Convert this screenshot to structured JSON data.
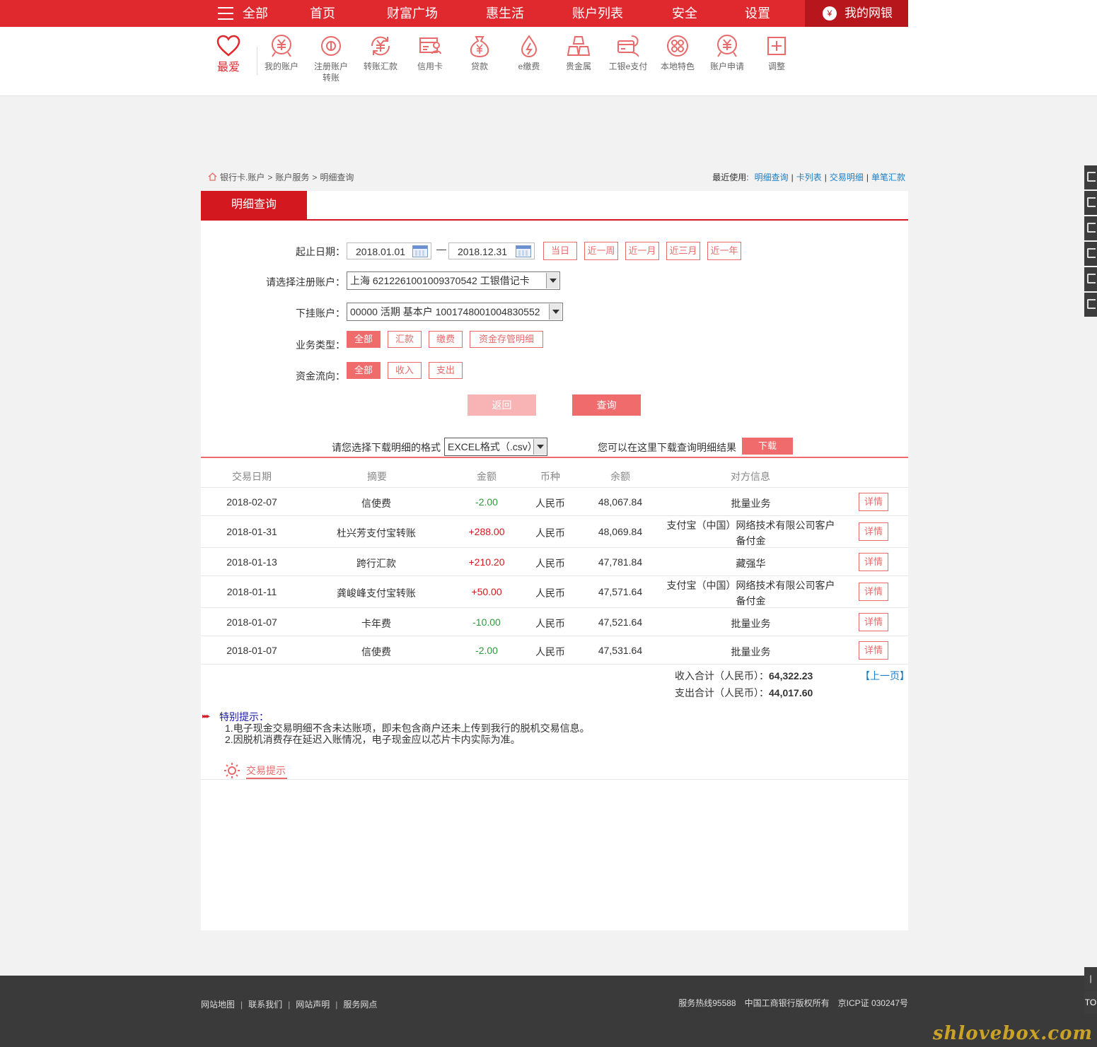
{
  "topnav": {
    "all": "全部",
    "items": [
      "首页",
      "财富广场",
      "惠生活",
      "账户列表",
      "安全",
      "设置"
    ],
    "mybank": "我的网银"
  },
  "iconbar": {
    "favorite": "最爱",
    "items": [
      "我的账户",
      "注册账户转账",
      "转账汇款",
      "信用卡",
      "贷款",
      "e缴费",
      "贵金属",
      "工银e支付",
      "本地特色",
      "账户申请",
      "调整"
    ]
  },
  "breadcrumb": [
    "银行卡.账户",
    "账户服务",
    "明细查询"
  ],
  "recent": {
    "label": "最近使用:",
    "links": [
      "明细查询",
      "卡列表",
      "交易明细",
      "单笔汇款"
    ]
  },
  "tab": "明细查询",
  "form": {
    "date_label": "起止日期：",
    "start_date": "2018.01.01",
    "end_date": "2018.12.31",
    "quick_ranges": [
      "当日",
      "近一周",
      "近一月",
      "近三月",
      "近一年"
    ],
    "account_label": "请选择注册账户：",
    "account_value": "上海 6212261001009370542 工银借记卡",
    "sub_account_label": "下挂账户：",
    "sub_account_value": "00000 活期 基本户 1001748001004830552",
    "biz_type_label": "业务类型：",
    "biz_types": [
      "全部",
      "汇款",
      "缴费",
      "资金存管明细"
    ],
    "flow_label": "资金流向：",
    "flows": [
      "全部",
      "收入",
      "支出"
    ],
    "back": "返回",
    "query": "查询"
  },
  "download": {
    "format_label": "请您选择下载明细的格式",
    "format_value": "EXCEL格式（.csv）",
    "hint": "您可以在这里下载查询明细结果",
    "button": "下载"
  },
  "table": {
    "headers": [
      "交易日期",
      "摘要",
      "金额",
      "币种",
      "余额",
      "对方信息"
    ],
    "rows": [
      {
        "date": "2018-02-07",
        "summary": "信使费",
        "amount": "-2.00",
        "currency": "人民币",
        "balance": "48,067.84",
        "party": "批量业务",
        "party2": "",
        "detail": "详情"
      },
      {
        "date": "2018-01-31",
        "summary": "杜兴芳支付宝转账",
        "amount": "+288.00",
        "currency": "人民币",
        "balance": "48,069.84",
        "party": "支付宝（中国）网络技术有限公司客户",
        "party2": "备付金",
        "detail": "详情"
      },
      {
        "date": "2018-01-13",
        "summary": "跨行汇款",
        "amount": "+210.20",
        "currency": "人民币",
        "balance": "47,781.84",
        "party": "藏强华",
        "party2": "",
        "detail": "详情"
      },
      {
        "date": "2018-01-11",
        "summary": "龚峻峰支付宝转账",
        "amount": "+50.00",
        "currency": "人民币",
        "balance": "47,571.64",
        "party": "支付宝（中国）网络技术有限公司客户",
        "party2": "备付金",
        "detail": "详情"
      },
      {
        "date": "2018-01-07",
        "summary": "卡年费",
        "amount": "-10.00",
        "currency": "人民币",
        "balance": "47,521.64",
        "party": "批量业务",
        "party2": "",
        "detail": "详情"
      },
      {
        "date": "2018-01-07",
        "summary": "信使费",
        "amount": "-2.00",
        "currency": "人民币",
        "balance": "47,531.64",
        "party": "批量业务",
        "party2": "",
        "detail": "详情"
      }
    ]
  },
  "summary": {
    "income_label": "收入合计（人民币）：",
    "income_value": "64,322.23",
    "expense_label": "支出合计（人民币）：",
    "expense_value": "44,017.60",
    "prev_page": "【上一页】"
  },
  "notice": {
    "title": "特别提示：",
    "lines": [
      "1.电子现金交易明细不含未达账项，即未包含商户还未上传到我行的脱机交易信息。",
      "2.因脱机消费存在延迟入账情况，电子现金应以芯片卡内实际为准。"
    ]
  },
  "trade_tip": "交易提示",
  "footer": {
    "links": [
      "网站地图",
      "联系我们",
      "网站声明",
      "服务网点"
    ],
    "hotline": "服务热线95588",
    "copyright": "中国工商银行版权所有",
    "icp": "京ICP证 030247号"
  },
  "totop": "TO",
  "watermark": "shlovebox.com",
  "colors": {
    "brand_red": "#e0292f",
    "dark_red": "#b8161d",
    "accent_pink": "#f06b6b",
    "negative_green": "#2b9b3a",
    "link_blue": "#1d7ec6"
  }
}
